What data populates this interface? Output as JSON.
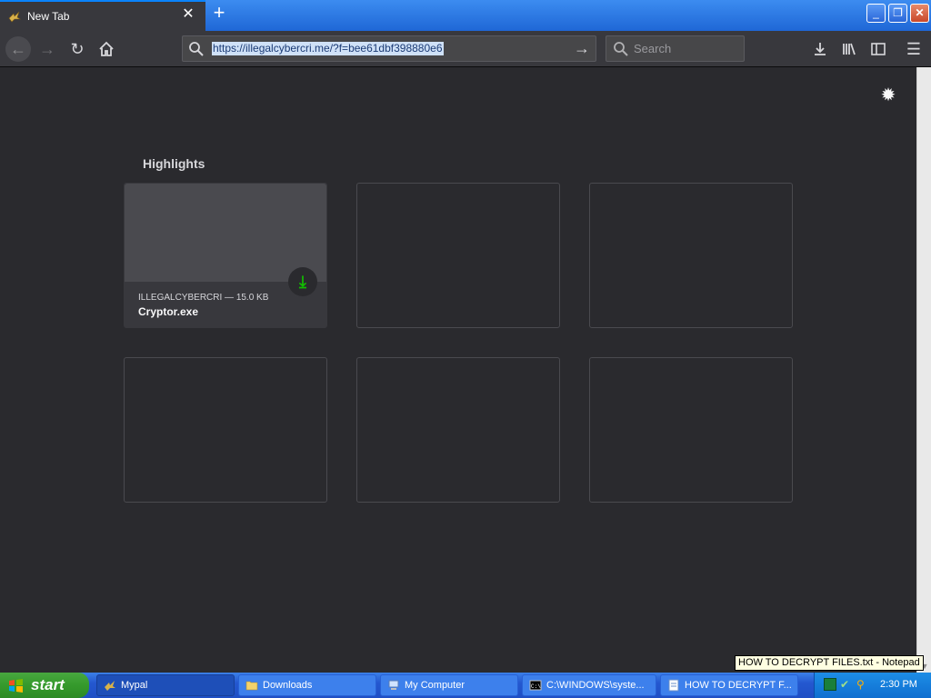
{
  "browser": {
    "tab_title": "New Tab",
    "url": "https://illegalcybercri.me/?f=bee61dbf398880e6",
    "search_placeholder": "Search"
  },
  "highlights": {
    "title": "Highlights",
    "cards": [
      {
        "meta": "ILLEGALCYBERCRI — 15.0 KB",
        "name": "Cryptor.exe"
      }
    ]
  },
  "tooltip": "HOW TO DECRYPT FILES.txt - Notepad",
  "taskbar": {
    "start_label": "start",
    "tasks": [
      {
        "label": "Mypal",
        "active": true
      },
      {
        "label": "Downloads"
      },
      {
        "label": "My Computer"
      },
      {
        "label": "C:\\WINDOWS\\syste..."
      },
      {
        "label": "HOW TO DECRYPT F..."
      }
    ],
    "clock": "2:30 PM"
  },
  "colors": {
    "accent": "#0a84ff",
    "download_green": "#12bc00",
    "page_bg": "#2a2a2e"
  }
}
